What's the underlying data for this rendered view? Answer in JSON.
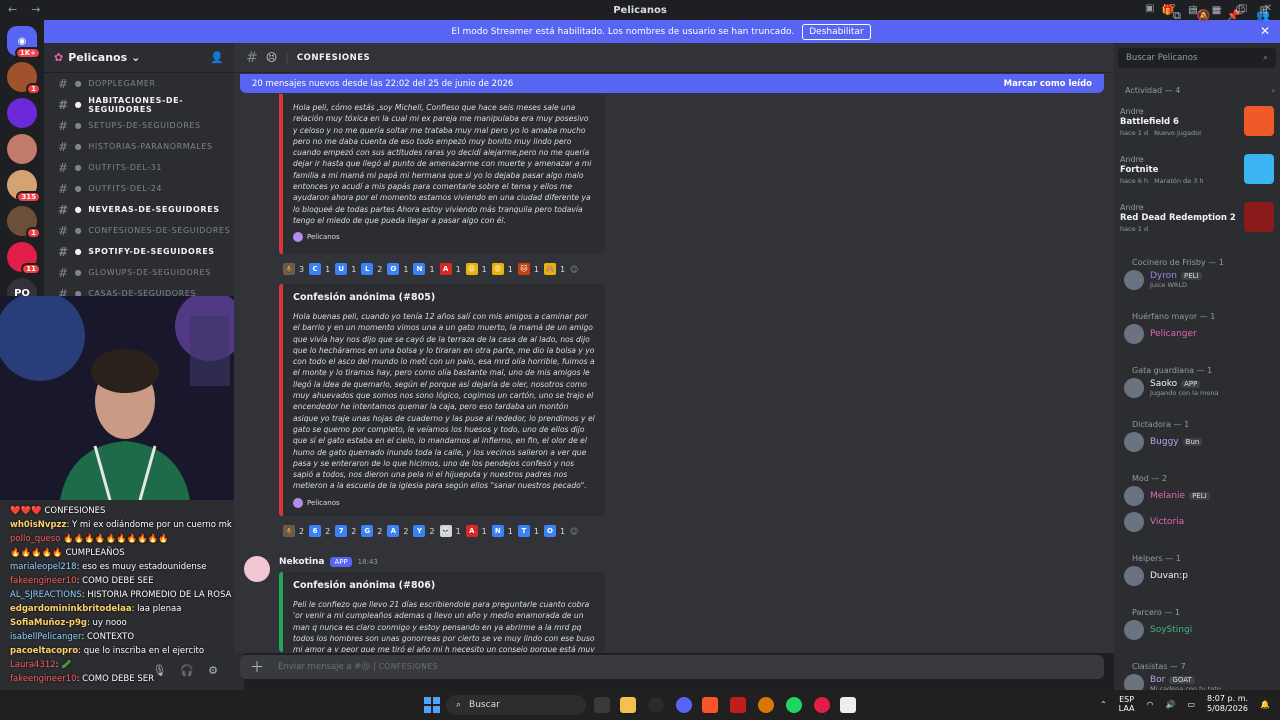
{
  "window": {
    "title": "Pelicanos"
  },
  "streamer_banner": {
    "text": "El modo Streamer está habilitado. Los nombres de usuario se han truncado.",
    "button": "Deshabilitar"
  },
  "servers": [
    {
      "badge": "1K+"
    },
    {
      "badge": "1"
    },
    {
      "badge": ""
    },
    {
      "badge": ""
    },
    {
      "badge": "315"
    },
    {
      "badge": "1"
    },
    {
      "badge": "11"
    },
    {
      "label": "PO"
    },
    {
      "badge": ""
    }
  ],
  "guild": {
    "name": "Pelicanos"
  },
  "channels": [
    {
      "name": "doppleGamer",
      "unread": false
    },
    {
      "name": "habitaciones-de-seguidores",
      "unread": true
    },
    {
      "name": "setups-de-seguidores",
      "unread": false
    },
    {
      "name": "historias-paranormales",
      "unread": false
    },
    {
      "name": "outfits-del-31",
      "unread": false
    },
    {
      "name": "outfits-del-24",
      "unread": false
    },
    {
      "name": "neveras-de-seguidores",
      "unread": true
    },
    {
      "name": "confesiones-de-seguidores",
      "unread": false
    },
    {
      "name": "spotify-de-seguidores",
      "unread": true
    },
    {
      "name": "glowups-de-seguidores",
      "unread": false
    },
    {
      "name": "casas-de-seguidores",
      "unread": false
    }
  ],
  "chat_overlay": [
    {
      "user": "",
      "text": "❤️❤️❤️ CONFESIONES"
    },
    {
      "user": "wh0isNvpzz",
      "text": ": Y mi ex odiándome por un cuerno mk"
    },
    {
      "user": "pollo_queso",
      "text": " 🔥🔥🔥🔥🔥🔥🔥🔥🔥🔥"
    },
    {
      "user": "",
      "text": "🔥🔥🔥🔥🔥 CUMPLEAÑOS"
    },
    {
      "user": "marialeopel218",
      "text": ": eso es muuy estadounidense"
    },
    {
      "user": "fakeengineer10",
      "text": ": COMO DEBE SEE"
    },
    {
      "user": "AL_SJREACTIONS",
      "text": ": HISTORIA PROMEDIO DE LA ROSA DE GUADALUPE"
    },
    {
      "user": "edgardomininkbritodelaa",
      "text": ": laa plenaa"
    },
    {
      "user": "SofiaMuñoz-p9g",
      "text": ": uy nooo"
    },
    {
      "user": "isabellPelicanger",
      "text": ": CONTEXTO"
    },
    {
      "user": "pacoeltacopro",
      "text": ": que lo inscriba en el ejercito"
    },
    {
      "user": "Laura4312",
      "text": ": 🥒"
    },
    {
      "user": "fakeengineer10",
      "text": ": COMO DEBE SER"
    }
  ],
  "channel_header": {
    "name": "CONFESIONES"
  },
  "new_messages_bar": {
    "text": "20 mensajes nuevos desde las 22:02 del 25 de junio de 2026",
    "action": "Marcar como leído"
  },
  "messages": [
    {
      "title": "Confesión anónima (#804)",
      "body": "Hola peli, cómo estás ,soy Michell, Confieso que hace seis meses sale una relación muy tóxica en la cual mi ex pareja me manipulaba era muy posesivo y celoso y no me quería soltar me trataba muy mal pero yo lo amaba mucho pero no me daba cuenta de eso todo empezó muy bonito muy lindo pero cuando empezó con sus actitudes raras yo decidí alejarme,pero no me quería dejar ir hasta que llegó al punto de amenazarme con muerte y amenazar a mi familia a mi mamá mi papá mi hermana que si yo lo dejaba pasar algo malo entonces yo acudí a mis papás para comentarle sobre el tema y ellos me ayudaron ahora por el momento estamos viviendo en una ciudad diferente ya lo bloqueé de todas partes Ahora estoy viviendo más tranquila pero todavía tengo el miedo de que pueda llegar a pasar algo con él.",
      "footer": "Pelicanos",
      "reactions": [
        {
          "emoji": "🧍",
          "count": "3",
          "color": "#6b5b4a"
        },
        {
          "emoji": "C",
          "count": "1",
          "color": "#3b82f6"
        },
        {
          "emoji": "U",
          "count": "1",
          "color": "#3b82f6"
        },
        {
          "emoji": "L",
          "count": "2",
          "color": "#3b82f6"
        },
        {
          "emoji": "O",
          "count": "1",
          "color": "#3b82f6"
        },
        {
          "emoji": "N",
          "count": "1",
          "color": "#3b82f6"
        },
        {
          "emoji": "A",
          "count": "1",
          "color": "#dc2626"
        },
        {
          "emoji": "😩",
          "count": "1",
          "color": "#eab308"
        },
        {
          "emoji": "😣",
          "count": "1",
          "color": "#eab308"
        },
        {
          "emoji": "🐱",
          "count": "1",
          "color": "#c2410c"
        },
        {
          "emoji": "🙈",
          "count": "1",
          "color": "#eab308"
        }
      ]
    },
    {
      "title": "Confesión anónima (#805)",
      "body": "Hola buenas peli, cuando yo tenía 12 años salí con mis amigos a caminar por el barrio y en un momento vimos una a un gato muerto, la mamá de un amigo que vivía hay nos dijo que se cayó de la terraza de la casa de al lado, nos dijo que lo hecháramos en una bolsa y lo tiraran en otra parte, me dio la bolsa y yo con todo el asco del mundo lo metí con un palo, esa mrd olía horrible, fuimos a el monte y lo tiramos hay, pero como olía bastante mal, uno de mis amigos le llegó la idea de quemarlo, según el porque así dejaría de oler, nosotros como muy ahuevados que somos nos sono lógico, cogimos un cartón, uno se trajo el encendedor he intentamos quemar la caja, pero eso tardaba un montón asique yo traje unas hojas de cuaderno y las puse al rededor, lo prendimos y el gato se quemo por completo, le veíamos los huesos y todo, uno de ellos dijo que sí el gato estaba en el cielo, lo mandamos al infierno, en fin, el olor de el humo de gato quemado inundo toda la calle, y los vecinos salieron a ver que pasa y se enteraron de lo que hicimos, uno de los pendejos confesó y nos sapió a todos, nos dieron una pela ni el hijueputa y nuestros padres nos metieron a la escuela de la iglesia para según ellos \"sanar nuestros pecado\".",
      "footer": "Pelicanos",
      "reactions": [
        {
          "emoji": "🧍",
          "count": "2",
          "color": "#6b5b4a"
        },
        {
          "emoji": "6",
          "count": "2",
          "color": "#3b82f6"
        },
        {
          "emoji": "7",
          "count": "2",
          "color": "#3b82f6"
        },
        {
          "emoji": "G",
          "count": "2",
          "color": "#3b82f6"
        },
        {
          "emoji": "A",
          "count": "2",
          "color": "#3b82f6"
        },
        {
          "emoji": "Y",
          "count": "2",
          "color": "#3b82f6"
        },
        {
          "emoji": "💀",
          "count": "1",
          "color": "#d4d4d4"
        },
        {
          "emoji": "A",
          "count": "1",
          "color": "#dc2626"
        },
        {
          "emoji": "N",
          "count": "1",
          "color": "#3b82f6"
        },
        {
          "emoji": "T",
          "count": "1",
          "color": "#3b82f6"
        },
        {
          "emoji": "O",
          "count": "1",
          "color": "#3b82f6"
        }
      ]
    },
    {
      "author": "Nekotina",
      "tag": "APP",
      "time": "18:43",
      "title": "Confesión anónima (#806)",
      "body": "Peli le confiezo que llevo 21 días escribiendole para preguntarle cuanto cobra 'or venir a mi cumpleaños ademas q llevo un año y medio enamorada de un man q nunca es claro conmigo y estoy pensando en ya abrirme a la mrd pq todos los hombres son unas gonorreas por cierto se ve muy lindo con ese buso mi amor a y peor que me tiró el año mi h necesito un consejo porque está muy duro"
    }
  ],
  "composer": {
    "placeholder": "Enviar mensaje a #",
    "channel": "CONFESIONES"
  },
  "member_search": {
    "placeholder": "Buscar Pelicanos"
  },
  "activity": {
    "header": "Actividad — 4",
    "items": [
      {
        "user": "Andre",
        "game": "Battlefield 6",
        "meta": "hace 1 d",
        "extra": "Nuevo jugador"
      },
      {
        "user": "Andre",
        "game": "Fortnite",
        "meta": "hace 6 h",
        "extra": "Maratón de 3 h"
      },
      {
        "user": "Andre",
        "game": "Red Dead Redemption 2",
        "meta": "hace 1 d",
        "extra": ""
      }
    ]
  },
  "member_groups": [
    {
      "role": "Cocinero de Frisby — 1",
      "members": [
        {
          "name": "Dyron",
          "tag": "PELI",
          "sub": "Juice WRLD",
          "color": "#9b84ec"
        }
      ]
    },
    {
      "role": "Huérfano mayor — 1",
      "members": [
        {
          "name": "Pelicanger",
          "tag": "",
          "sub": "",
          "color": "#e667af"
        }
      ]
    },
    {
      "role": "Gata guardiana — 1",
      "members": [
        {
          "name": "Saoko",
          "tag": "APP",
          "sub": "Jugando con la mona",
          "color": "#f2f3f5"
        }
      ]
    },
    {
      "role": "Dictadora — 1",
      "members": [
        {
          "name": "Buggy",
          "tag": "Bun",
          "sub": "",
          "color": "#b9a4f0"
        }
      ]
    },
    {
      "role": "Mod — 2",
      "members": [
        {
          "name": "Melanie",
          "tag": "PELI",
          "sub": "",
          "color": "#e667af"
        },
        {
          "name": "Victoria",
          "tag": "",
          "sub": "",
          "color": "#e667af"
        }
      ]
    },
    {
      "role": "Helpers — 1",
      "members": [
        {
          "name": "Duvan:p",
          "tag": "",
          "sub": "",
          "color": "#f2f3f5"
        }
      ]
    },
    {
      "role": "Parcero — 1",
      "members": [
        {
          "name": "SoyStingi",
          "tag": "",
          "sub": "",
          "color": "#43b581"
        }
      ]
    },
    {
      "role": "Clasistas — 7",
      "members": [
        {
          "name": "Bor",
          "tag": "GOAT",
          "sub": "Mi cadena con tu toto",
          "color": "#b9a4f0"
        }
      ]
    }
  ],
  "taskbar": {
    "search": "Buscar",
    "lang": "ESP",
    "lang2": "LAA",
    "time": "8:07 p. m.",
    "date": "5/08/2026"
  },
  "colors": {
    "accent": "#5865f2",
    "danger": "#da373c",
    "success": "#23a55a"
  }
}
